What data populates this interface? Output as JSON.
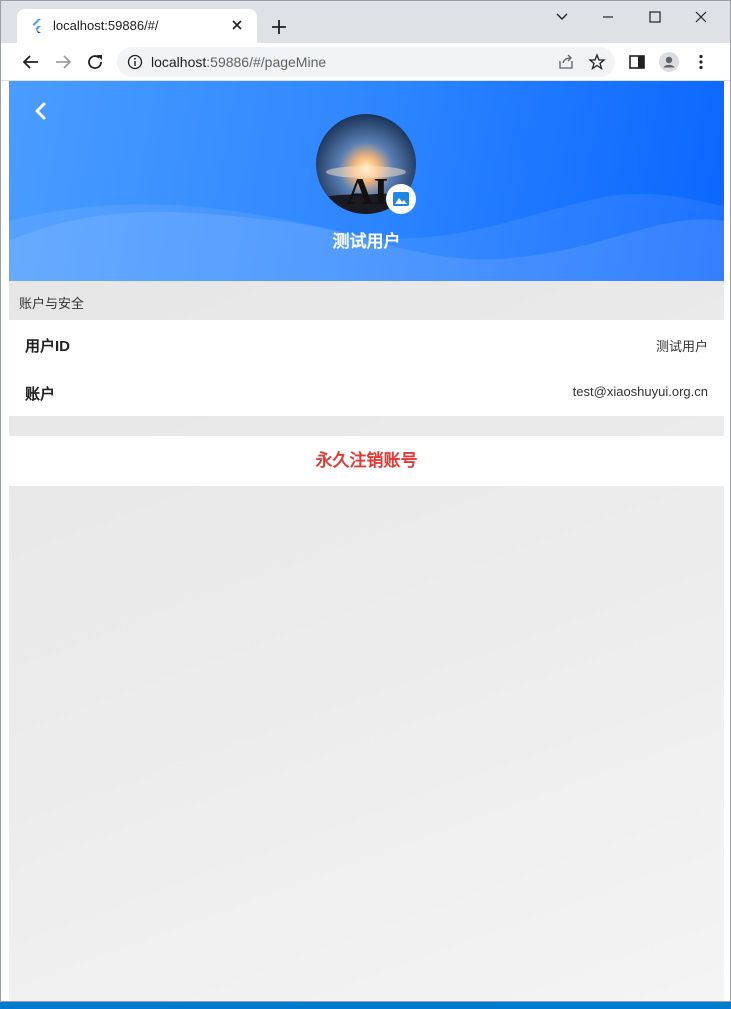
{
  "browser": {
    "tab_title": "localhost:59886/#/",
    "url_host": "localhost",
    "url_rest": ":59886/#/pageMine"
  },
  "icons": {
    "back": "chevron-left-icon",
    "avatar_badge": "image-icon"
  },
  "profile": {
    "username": "测试用户",
    "avatar_text": "AI"
  },
  "section": {
    "label": "账户与安全"
  },
  "rows": [
    {
      "label": "用户ID",
      "value": "测试用户"
    },
    {
      "label": "账户",
      "value": "test@xiaoshuyui.org.cn"
    }
  ],
  "actions": {
    "delete_account": "永久注销账号"
  },
  "colors": {
    "header_start": "#4a9cff",
    "header_end": "#0a66ff",
    "danger": "#e53935"
  }
}
